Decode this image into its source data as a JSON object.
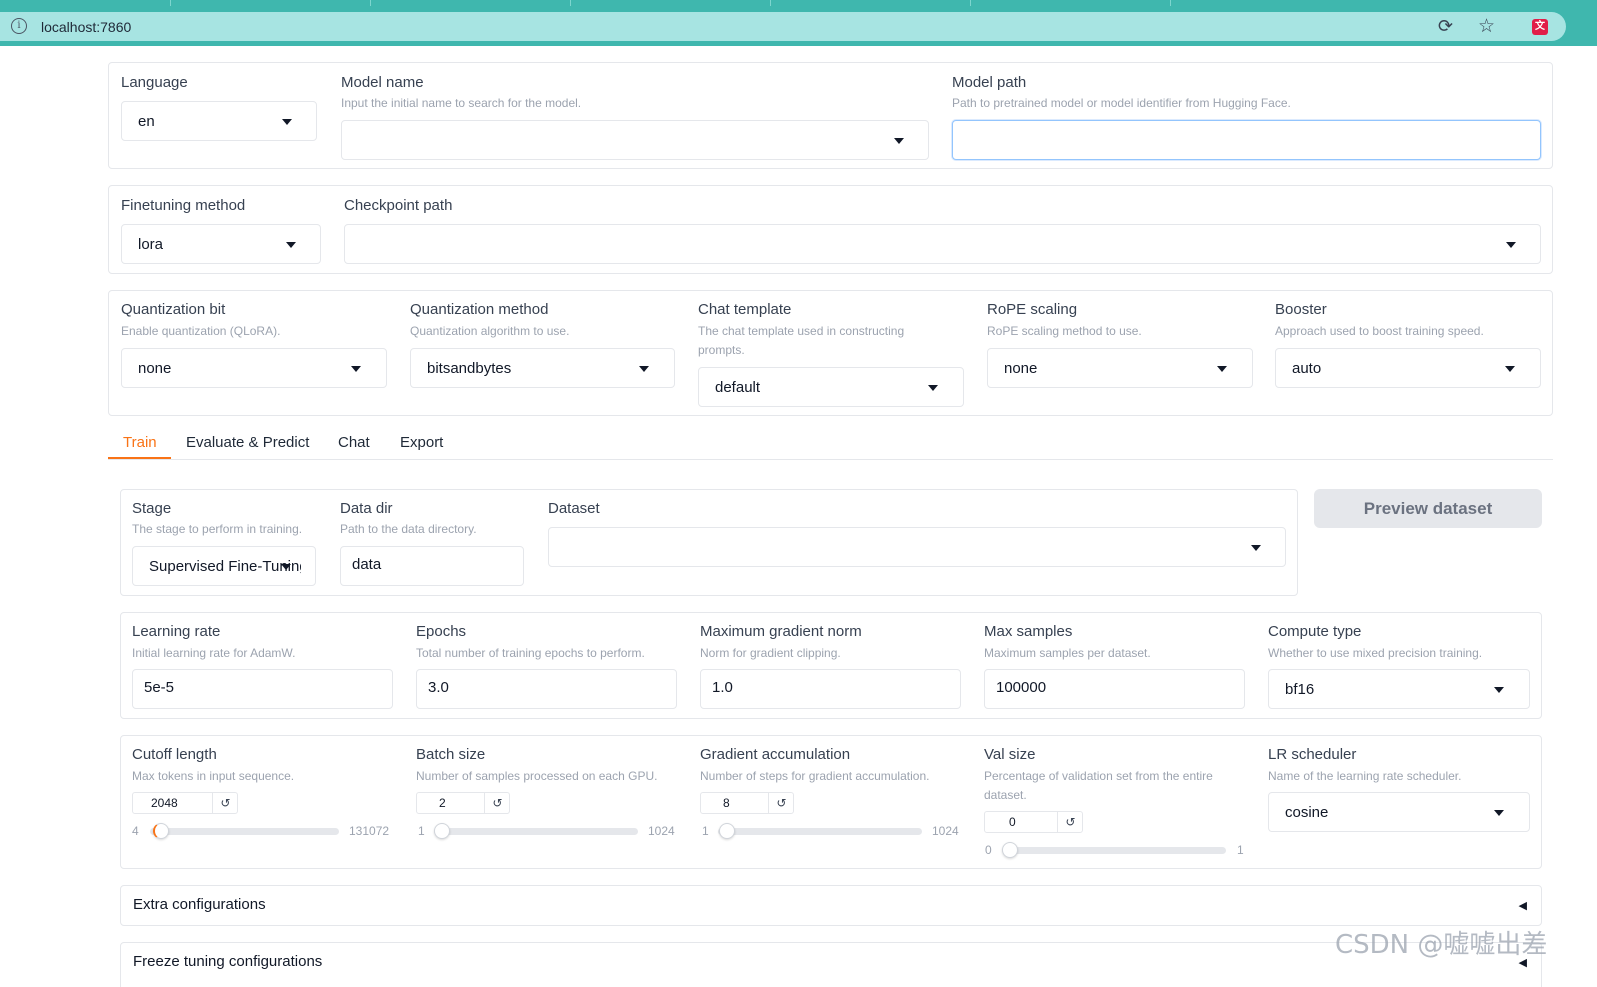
{
  "browser": {
    "url": "localhost:7860"
  },
  "top": {
    "language": {
      "label": "Language",
      "value": "en"
    },
    "model_name": {
      "label": "Model name",
      "info": "Input the initial name to search for the model.",
      "value": ""
    },
    "model_path": {
      "label": "Model path",
      "info": "Path to pretrained model or model identifier from Hugging Face.",
      "value": ""
    }
  },
  "finetune": {
    "method": {
      "label": "Finetuning method",
      "value": "lora"
    },
    "checkpoint": {
      "label": "Checkpoint path",
      "value": ""
    }
  },
  "advanced": {
    "quant_bit": {
      "label": "Quantization bit",
      "info": "Enable quantization (QLoRA).",
      "value": "none"
    },
    "quant_method": {
      "label": "Quantization method",
      "info": "Quantization algorithm to use.",
      "value": "bitsandbytes"
    },
    "chat_template": {
      "label": "Chat template",
      "info": "The chat template used in constructing prompts.",
      "value": "default"
    },
    "rope": {
      "label": "RoPE scaling",
      "info": "RoPE scaling method to use.",
      "value": "none"
    },
    "booster": {
      "label": "Booster",
      "info": "Approach used to boost training speed.",
      "value": "auto"
    }
  },
  "tabs": [
    "Train",
    "Evaluate & Predict",
    "Chat",
    "Export"
  ],
  "train": {
    "stage": {
      "label": "Stage",
      "info": "The stage to perform in training.",
      "value": "Supervised Fine-Tuning"
    },
    "data_dir": {
      "label": "Data dir",
      "info": "Path to the data directory.",
      "value": "data"
    },
    "dataset": {
      "label": "Dataset",
      "value": ""
    },
    "preview_button": "Preview dataset",
    "learning_rate": {
      "label": "Learning rate",
      "info": "Initial learning rate for AdamW.",
      "value": "5e-5"
    },
    "epochs": {
      "label": "Epochs",
      "info": "Total number of training epochs to perform.",
      "value": "3.0"
    },
    "max_grad_norm": {
      "label": "Maximum gradient norm",
      "info": "Norm for gradient clipping.",
      "value": "1.0"
    },
    "max_samples": {
      "label": "Max samples",
      "info": "Maximum samples per dataset.",
      "value": "100000"
    },
    "compute_type": {
      "label": "Compute type",
      "info": "Whether to use mixed precision training.",
      "value": "bf16"
    },
    "cutoff_len": {
      "label": "Cutoff length",
      "info": "Max tokens in input sequence.",
      "value": "2048",
      "min": "4",
      "max": "131072",
      "fraction": 0.016
    },
    "batch_size": {
      "label": "Batch size",
      "info": "Number of samples processed on each GPU.",
      "value": "2",
      "min": "1",
      "max": "1024",
      "fraction": 0.001
    },
    "grad_accum": {
      "label": "Gradient accumulation",
      "info": "Number of steps for gradient accumulation.",
      "value": "8",
      "min": "1",
      "max": "1024",
      "fraction": 0.007
    },
    "val_size": {
      "label": "Val size",
      "info": "Percentage of validation set from the entire dataset.",
      "value": "0",
      "min": "0",
      "max": "1",
      "fraction": 0
    },
    "lr_scheduler": {
      "label": "LR scheduler",
      "info": "Name of the learning rate scheduler.",
      "value": "cosine"
    },
    "extra_config": "Extra configurations",
    "freeze_config": "Freeze tuning configurations",
    "reset_glyph": "↺",
    "collapse_glyph": "◀"
  },
  "watermark": "CSDN @嘘嘘出差"
}
